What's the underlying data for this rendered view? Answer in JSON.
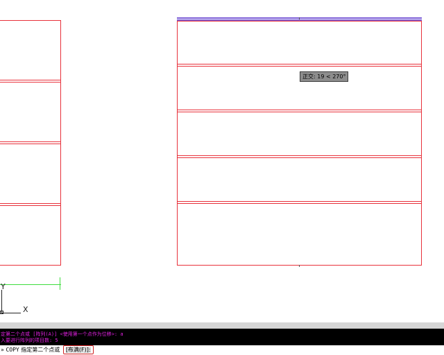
{
  "tooltip": {
    "text": "正交: 19 < 270°"
  },
  "ucs": {
    "y_label": "Y",
    "x_label": "X"
  },
  "command_history": [
    "定第二个点或 [阵列(A)] <使用第一个点作为位移>: a",
    "入要进行阵列的项目数: 5"
  ],
  "command_line": {
    "icon": "»",
    "command": "COPY",
    "prompt": "指定第二个点或",
    "option": "[布满(F)]:"
  },
  "colors": {
    "geometry": "#e8303a",
    "highlight": "#7b5cd6",
    "axis_green": "#3cdc3c",
    "history_text": "#e020e0"
  }
}
